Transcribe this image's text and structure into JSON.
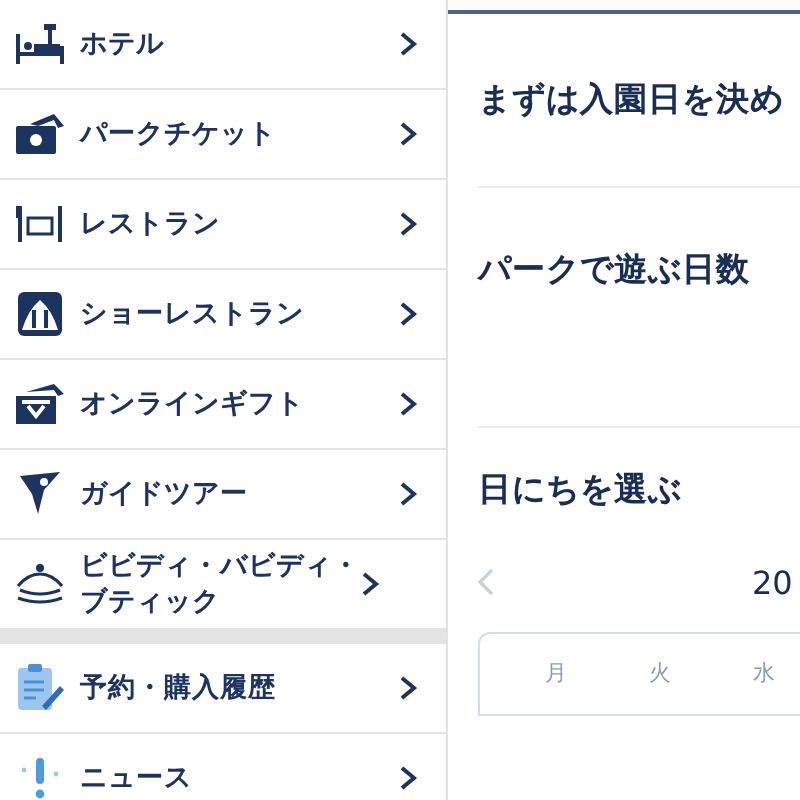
{
  "menu": {
    "groups": [
      {
        "items": [
          {
            "label": "ホテル"
          },
          {
            "label": "パークチケット"
          },
          {
            "label": "レストラン"
          },
          {
            "label": "ショーレストラン"
          },
          {
            "label": "オンラインギフト"
          },
          {
            "label": "ガイドツアー"
          },
          {
            "label": "ビビディ・バビディ・ブティック"
          }
        ]
      },
      {
        "items": [
          {
            "label": "予約・購入履歴"
          },
          {
            "label": "ニュース"
          }
        ]
      }
    ]
  },
  "main": {
    "sections": [
      {
        "heading": "まずは入園日を決め"
      },
      {
        "heading": "パークで遊ぶ日数"
      },
      {
        "heading": "日にちを選ぶ"
      }
    ],
    "calendar": {
      "month": "20",
      "weekdays": [
        "月",
        "火",
        "水"
      ]
    }
  }
}
